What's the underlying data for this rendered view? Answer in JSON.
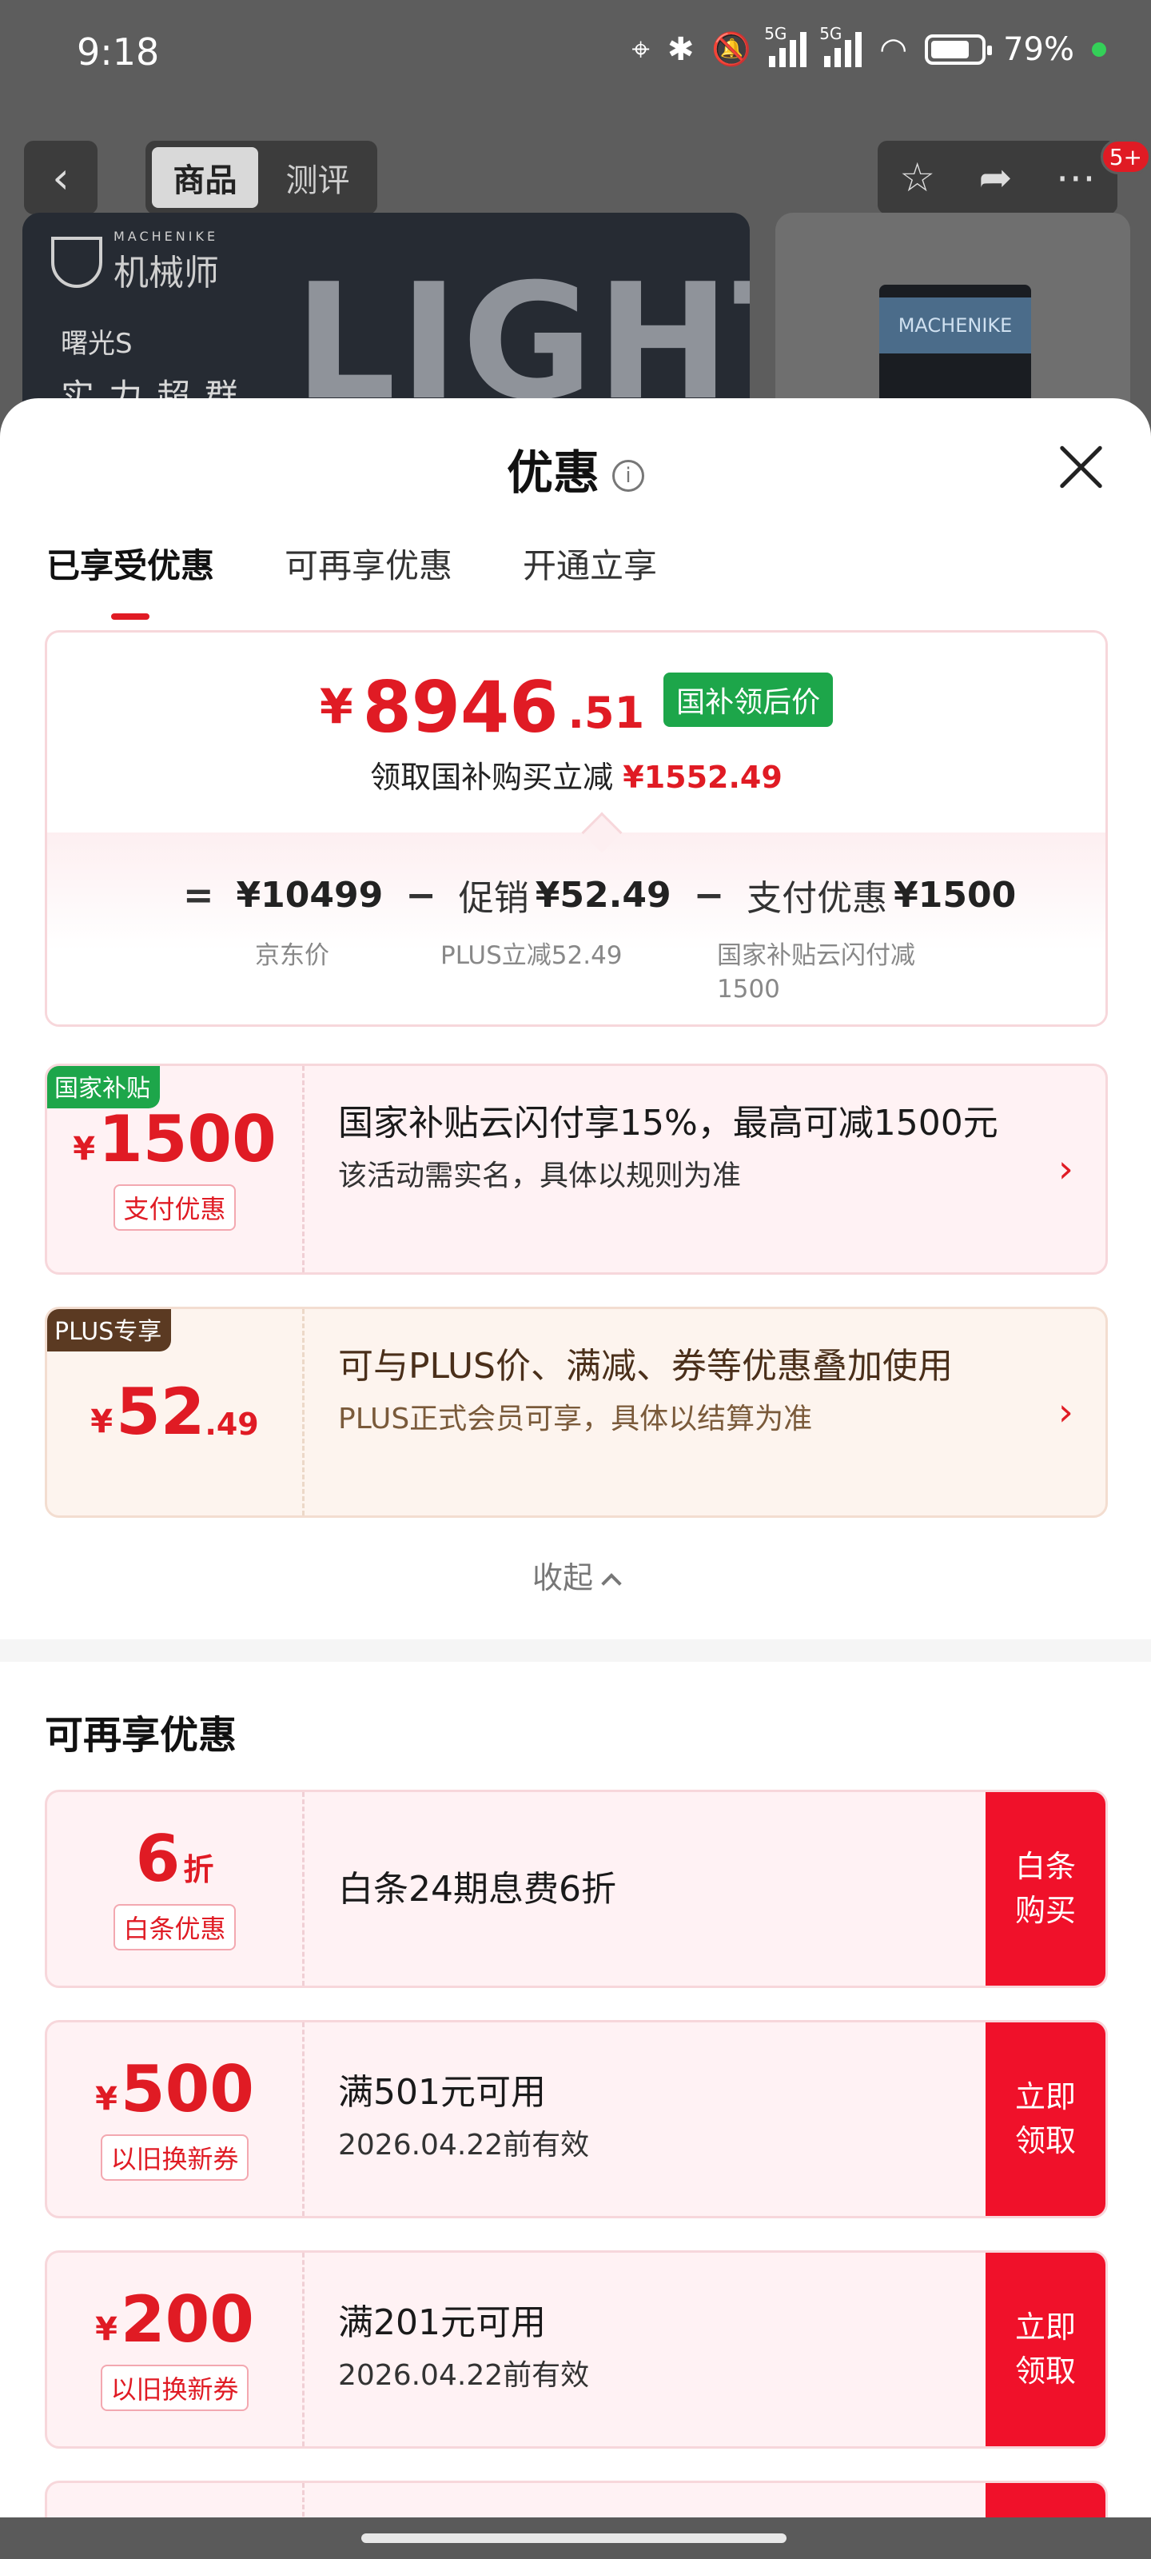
{
  "status": {
    "time": "9:18",
    "battery": "79%",
    "net": "5G"
  },
  "nav": {
    "tabs": [
      "商品",
      "测评"
    ],
    "badge": "5+"
  },
  "banner": {
    "brand": "机械师",
    "brand_en": "MACHENIKE",
    "product": "曙光S",
    "slogan": "实力超群",
    "word": "LIGHTS",
    "box_label": "MACHENIKE"
  },
  "sheet": {
    "title": "优惠",
    "tabs": [
      "已享受优惠",
      "可再享优惠",
      "开通立享"
    ],
    "summary": {
      "yen": "¥",
      "price_int": "8946",
      "price_dec": ".51",
      "tag": "国补领后价",
      "sub_text": "领取国补购买立减",
      "sub_amount": "¥1552.49",
      "eq": "=",
      "minus": "−",
      "base_value": "¥10499",
      "base_label": "京东价",
      "promo_name": "促销",
      "promo_value": "¥52.49",
      "promo_label": "PLUS立减52.49",
      "pay_name": "支付优惠",
      "pay_value": "¥1500",
      "pay_label_1": "国家补贴云闪付减",
      "pay_label_2": "1500"
    },
    "enjoyed": [
      {
        "corner": "国家补贴",
        "yen": "¥",
        "amount": "1500",
        "label": "支付优惠",
        "title": "国家补贴云闪付享15%，最高可减1500元",
        "desc": "该活动需实名，具体以规则为准",
        "arrow": "›"
      },
      {
        "corner": "PLUS专享",
        "yen": "¥",
        "amount": "52",
        "amount_dec": ".49",
        "title": "可与PLUS价、满减、券等优惠叠加使用",
        "desc": "PLUS正式会员可享，具体以结算为准",
        "arrow": "›"
      }
    ],
    "collapse": "收起",
    "more_title": "可再享优惠",
    "more": [
      {
        "amount": "6",
        "unit": "折",
        "label": "白条优惠",
        "title": "白条24期息费6折",
        "btn": "白条购买"
      },
      {
        "yen": "¥",
        "amount": "500",
        "label": "以旧换新券",
        "title": "满501元可用",
        "desc": "2026.04.22前有效",
        "btn": "立即领取"
      },
      {
        "yen": "¥",
        "amount": "200",
        "label": "以旧换新券",
        "title": "满201元可用",
        "desc": "2026.04.22前有效",
        "btn": "立即领取"
      }
    ]
  }
}
